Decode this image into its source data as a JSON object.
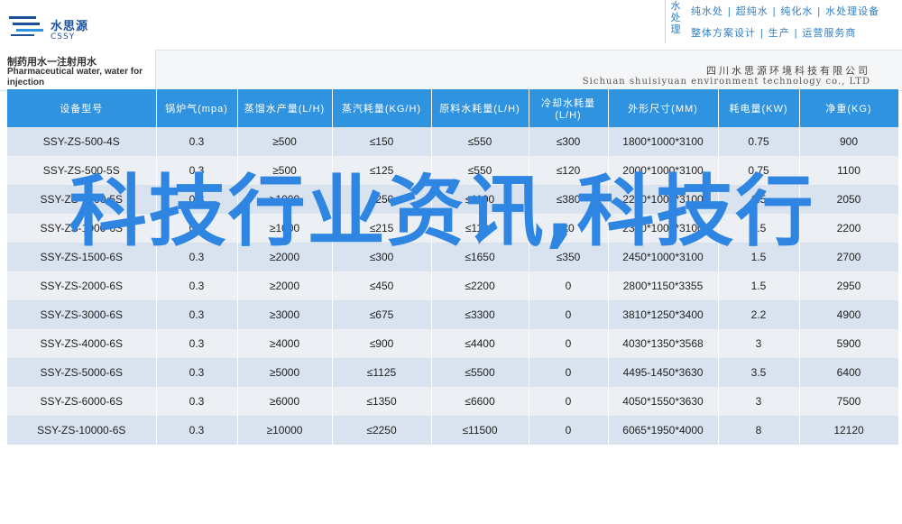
{
  "logo": {
    "name_cn": "水思源",
    "name_en": "CSSY",
    "mark_icon": "water-drop-lines-icon"
  },
  "brand": {
    "vertical": "水处理",
    "line1": "纯水处 | 超纯水 | 纯化水 | 水处理设备",
    "line2": "整体方案设计 | 生产 | 运营服务商"
  },
  "title": {
    "cn": "制药用水一注射用水",
    "en": "Pharmaceutical water, water for injection"
  },
  "company": {
    "cn": "四川水思源环境科技有限公司",
    "en": "Sichuan shuisiyuan environment technology co., LTD"
  },
  "table": {
    "headers": [
      "设备型号",
      "锅炉气(mpa)",
      "蒸馏水产量(L/H)",
      "蒸汽耗量(KG/H)",
      "原料水耗量(L/H)",
      "冷却水耗量(L/H)",
      "外形尺寸(MM)",
      "耗电量(KW)",
      "净重(KG)"
    ],
    "rows": [
      [
        "SSY-ZS-500-4S",
        "0.3",
        "≥500",
        "≤150",
        "≤550",
        "≤300",
        "1800*1000*3100",
        "0.75",
        "900"
      ],
      [
        "SSY-ZS-500-5S",
        "0.3",
        "≥500",
        "≤125",
        "≤550",
        "≤120",
        "2000*1000*3100",
        "0.75",
        "1100"
      ],
      [
        "SSY-ZS-1000-5S",
        "0.3",
        "≥1000",
        "≤250",
        "≤1100",
        "≤380",
        "2200*1000*3100",
        "1.5",
        "2050"
      ],
      [
        "SSY-ZS-1000-6S",
        "0.3",
        "≥1000",
        "≤215",
        "≤1100",
        "≤0",
        "2300*1000*3100",
        "1.5",
        "2200"
      ],
      [
        "SSY-ZS-1500-6S",
        "0.3",
        "≥2000",
        "≤300",
        "≤1650",
        "≤350",
        "2450*1000*3100",
        "1.5",
        "2700"
      ],
      [
        "SSY-ZS-2000-6S",
        "0.3",
        "≥2000",
        "≤450",
        "≤2200",
        "0",
        "2800*1150*3355",
        "1.5",
        "2950"
      ],
      [
        "SSY-ZS-3000-6S",
        "0.3",
        "≥3000",
        "≤675",
        "≤3300",
        "0",
        "3810*1250*3400",
        "2.2",
        "4900"
      ],
      [
        "SSY-ZS-4000-6S",
        "0.3",
        "≥4000",
        "≤900",
        "≤4400",
        "0",
        "4030*1350*3568",
        "3",
        "5900"
      ],
      [
        "SSY-ZS-5000-6S",
        "0.3",
        "≥5000",
        "≤1125",
        "≤5500",
        "0",
        "4495-1450*3630",
        "3.5",
        "6400"
      ],
      [
        "SSY-ZS-6000-6S",
        "0.3",
        "≥6000",
        "≤1350",
        "≤6600",
        "0",
        "4050*1550*3630",
        "3",
        "7500"
      ],
      [
        "SSY-ZS-10000-6S",
        "0.3",
        "≥10000",
        "≤2250",
        "≤11500",
        "0",
        "6065*1950*4000",
        "8",
        "12120"
      ]
    ]
  },
  "overlay_text": "科技行业资讯,科技行"
}
